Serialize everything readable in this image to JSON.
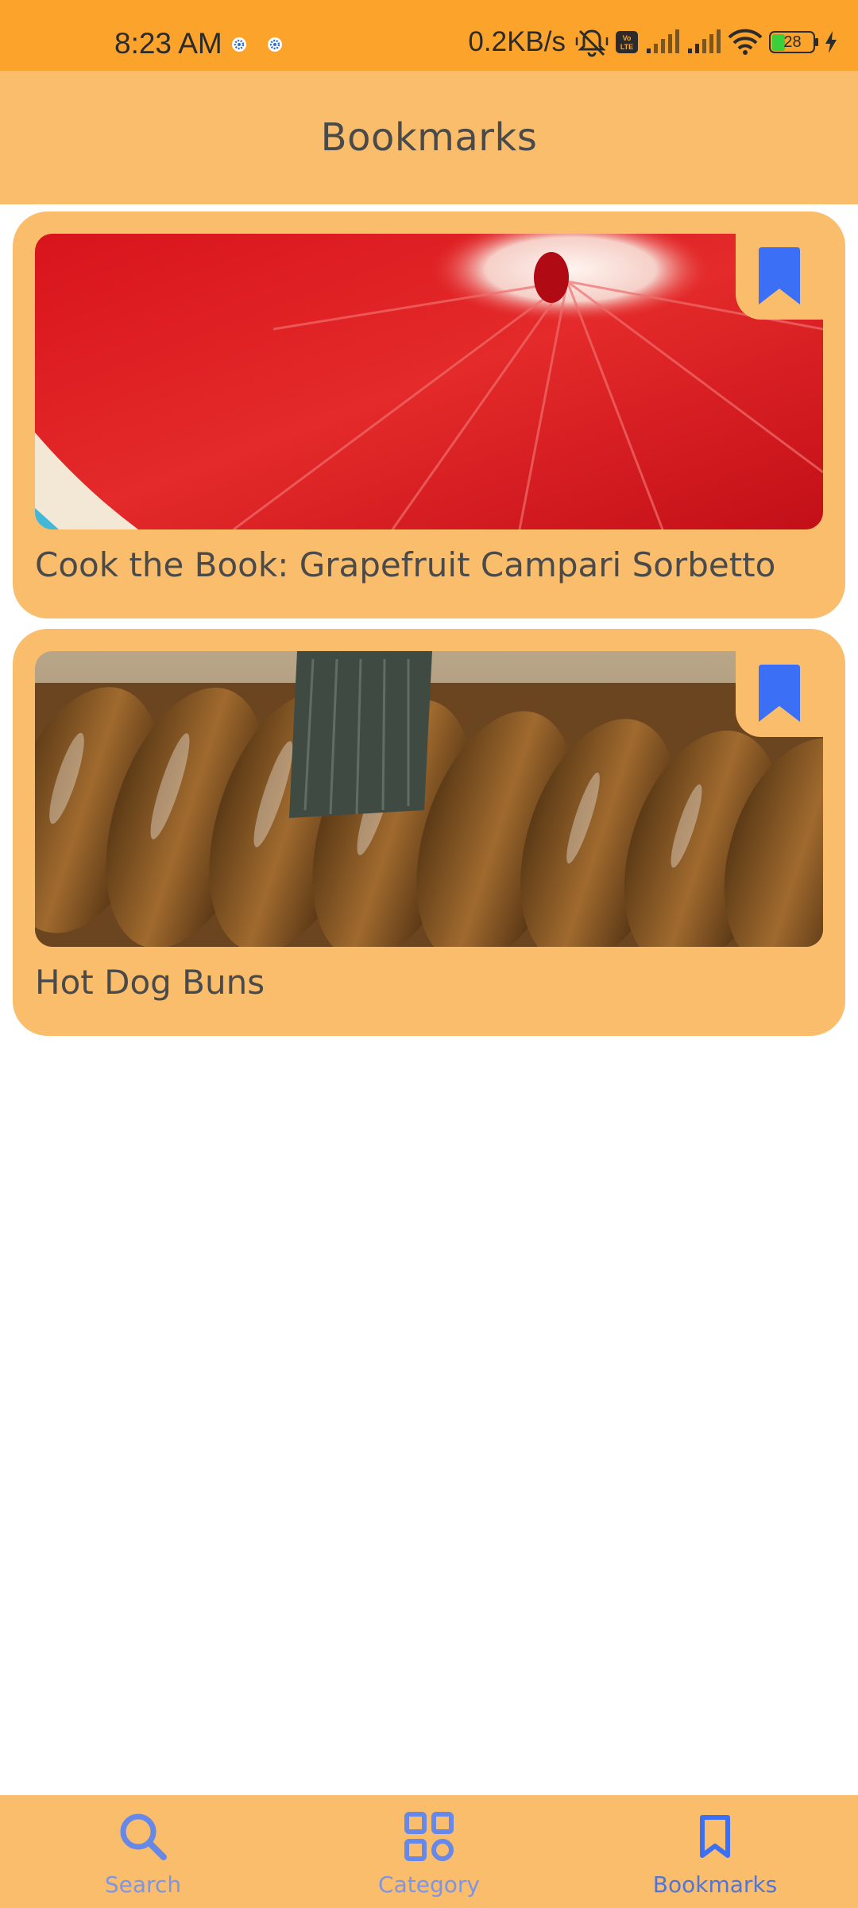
{
  "status_bar": {
    "time": "8:23 AM",
    "net_speed": "0.2KB/s",
    "volte": "Vo\nLTE",
    "battery": "28"
  },
  "app_bar": {
    "title": "Bookmarks"
  },
  "bookmarks": [
    {
      "title": "Cook the Book: Grapefruit Campari Sorbetto",
      "image": "grapefruit-photo",
      "bookmarked": true
    },
    {
      "title": "Hot Dog Buns",
      "image": "bread-photo",
      "bookmarked": true
    }
  ],
  "bottom_nav": {
    "items": [
      {
        "label": "Search",
        "icon": "search-icon",
        "active": false
      },
      {
        "label": "Category",
        "icon": "grid-icon",
        "active": false
      },
      {
        "label": "Bookmarks",
        "icon": "bookmark-outline-icon",
        "active": true
      }
    ]
  },
  "colors": {
    "status_bar": "#FCA32C",
    "app_bar": "#F9BD6B",
    "accent": "#3B6FF5",
    "nav_icon": "#6688E8"
  }
}
